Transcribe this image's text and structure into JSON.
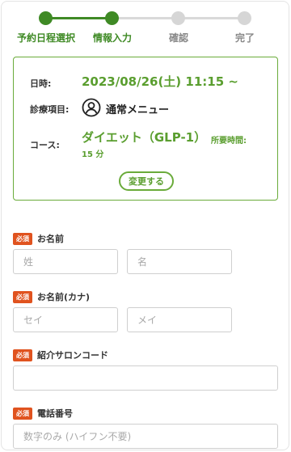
{
  "stepper": {
    "steps": [
      {
        "label": "予約日程選択",
        "state": "done"
      },
      {
        "label": "情報入力",
        "state": "current"
      },
      {
        "label": "確認",
        "state": "pending"
      },
      {
        "label": "完了",
        "state": "pending"
      }
    ],
    "active_color": "#3f8a25",
    "inactive_color": "#d6d6d6"
  },
  "summary": {
    "datetime_label": "日時:",
    "datetime_value": "2023/08/26(土) 11:15 ~",
    "menu_label": "診療項目:",
    "menu_icon": "user-circle-icon",
    "menu_value": "通常メニュー",
    "course_label": "コース:",
    "course_value": "ダイエット（GLP-1）",
    "duration_label": "所要時間:",
    "duration_value": "15 分",
    "change_button": "変更する"
  },
  "form": {
    "required_badge": "必須",
    "name": {
      "label": "お名前",
      "last_placeholder": "姓",
      "first_placeholder": "名"
    },
    "kana": {
      "label": "お名前(カナ)",
      "last_placeholder": "セイ",
      "first_placeholder": "メイ"
    },
    "salon_code": {
      "label": "紹介サロンコード",
      "placeholder": ""
    },
    "phone": {
      "label": "電話番号",
      "placeholder": "数字のみ (ハイフン不要)"
    }
  },
  "colors": {
    "accent": "#5a9e2f",
    "border_accent": "#6aab3a",
    "required": "#e0531f"
  }
}
